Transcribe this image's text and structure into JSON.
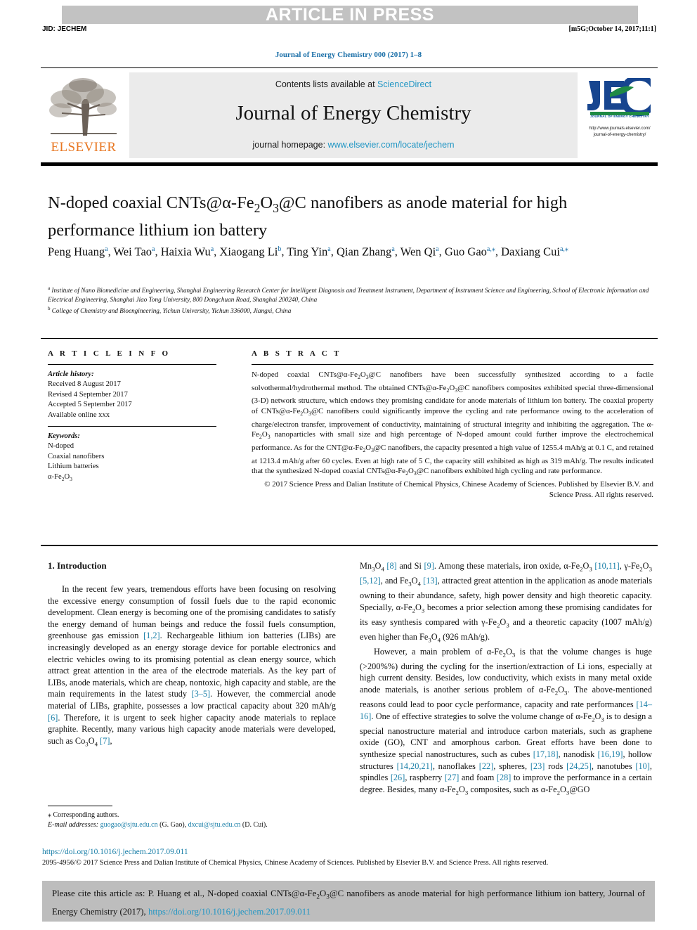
{
  "header": {
    "press_banner": "ARTICLE IN PRESS",
    "jid": "JID: JECHEM",
    "stamp": "[m5G;October 14, 2017;11:1]",
    "journal_ref": "Journal of Energy Chemistry 000 (2017) 1–8"
  },
  "masthead": {
    "contents_prefix": "Contents lists available at ",
    "contents_link": "ScienceDirect",
    "journal_name": "Journal of Energy Chemistry",
    "homepage_prefix": "journal homepage: ",
    "homepage_link": "www.elsevier.com/locate/jechem",
    "elsevier_wordmark": "ELSEVIER",
    "jec_mark": "JEC",
    "jec_subtitle": "JOURNAL OF ENERGY CHEMISTRY",
    "jec_url_line1": "http://www.journals.elsevier.com/",
    "jec_url_line2": "journal-of-energy-chemistry/"
  },
  "article": {
    "title_html": "N-doped coaxial CNTs@&#945;-Fe<sub>2</sub>O<sub>3</sub>@C nanofibers as anode material for high performance lithium ion battery",
    "authors_html": "Peng Huang<sup>a</sup>, Wei Tao<sup>a</sup>, Haixia Wu<sup>a</sup>, Xiaogang Li<sup>b</sup>, Ting Yin<sup>a</sup>, Qian Zhang<sup>a</sup>, Wen Qi<sup>a</sup>, Guo Gao<sup>a,&#8270;</sup>, Daxiang Cui<sup>a,&#8270;</sup>",
    "affiliation_a": "Institute of Nano Biomedicine and Engineering, Shanghai Engineering Research Center for Intelligent Diagnosis and Treatment Instrument, Department of Instrument Science and Engineering, School of Electronic Information and Electrical Engineering, Shanghai Jiao Tong University, 800 Dongchuan Road, Shanghai 200240, China",
    "affiliation_b": "College of Chemistry and Bioengineering, Yichun University, Yichun 336000, Jiangxi, China"
  },
  "article_info": {
    "heading": "A R T I C L E   I N F O",
    "history_label": "Article history:",
    "history": [
      "Received 8 August 2017",
      "Revised 4 September 2017",
      "Accepted 5 September 2017",
      "Available online xxx"
    ],
    "keywords_label": "Keywords:",
    "keywords_html": [
      "N-doped",
      "Coaxial nanofibers",
      "Lithium batteries",
      "&#945;-Fe<sub>2</sub>O<sub>3</sub>"
    ]
  },
  "abstract": {
    "heading": "A B S T R A C T",
    "body_html": "N-doped coaxial CNTs@&#945;-Fe<sub>2</sub>O<sub>3</sub>@C nanofibers have been successfully synthesized according to a facile solvothermal/hydrothermal method. The obtained CNTs@&#945;-Fe<sub>2</sub>O<sub>3</sub>@C nanofibers composites exhibited special three-dimensional (3-D) network structure, which endows they promising candidate for anode materials of lithium ion battery. The coaxial property of CNTs@&#945;-Fe<sub>2</sub>O<sub>3</sub>@C nanofibers could significantly improve the cycling and rate performance owing to the acceleration of charge/electron transfer, improvement of conductivity, maintaining of structural integrity and inhibiting the aggregation. The &#945;-Fe<sub>2</sub>O<sub>3</sub> nanoparticles with small size and high percentage of N-doped amount could further improve the electrochemical performance. As for the CNT@&#945;-Fe<sub>2</sub>O<sub>3</sub>@C nanofibers, the capacity presented a high value of 1255.4 mAh/g at 0.1 C, and retained at 1213.4 mAh/g after 60 cycles. Even at high rate of 5 C, the capacity still exhibited as high as 319 mAh/g. The results indicated that the synthesized N-doped coaxial CNTs@&#945;-Fe<sub>2</sub>O<sub>3</sub>@C nanofibers exhibited high cycling and rate performance.",
    "copyright_html": "&#169; 2017 Science Press and Dalian Institute of Chemical Physics, Chinese Academy of Sciences. Published by Elsevier B.V. and Science Press. All rights reserved."
  },
  "introduction": {
    "heading": "1. Introduction",
    "left_paragraph_html": "In the recent few years, tremendous efforts have been focusing on resolving the excessive energy consumption of fossil fuels due to the rapid economic development. Clean energy is becoming one of the promising candidates to satisfy the energy demand of human beings and reduce the fossil fuels consumption, greenhouse gas emission <span class=\"cite\">[1,2]</span>. Rechargeable lithium ion batteries (LIBs) are increasingly developed as an energy storage device for portable electronics and electric vehicles owing to its promising potential as clean energy source, which attract great attention in the area of the electrode materials. As the key part of LIBs, anode materials, which are cheap, nontoxic, high capacity and stable, are the main requirements in the latest study <span class=\"cite\">[3&#8211;5]</span>. However, the commercial anode material of LIBs, graphite, possesses a low practical capacity about 320 mAh/g <span class=\"cite\">[6]</span>. Therefore, it is urgent to seek higher capacity anode materials to replace graphite. Recently, many various high capacity anode materials were developed, such as Co<sub>3</sub>O<sub>4</sub> <span class=\"cite\">[7]</span>,",
    "right_paragraph_1_html": "Mn<sub>3</sub>O<sub>4</sub> <span class=\"cite\">[8]</span> and Si <span class=\"cite\">[9]</span>. Among these materials, iron oxide, &#945;-Fe<sub>2</sub>O<sub>3</sub> <span class=\"cite\">[10,11]</span>, &#947;-Fe<sub>2</sub>O<sub>3</sub> <span class=\"cite\">[5,12]</span>, and Fe<sub>3</sub>O<sub>4</sub> <span class=\"cite\">[13]</span>, attracted great attention in the application as anode materials owning to their abundance, safety, high power density and high theoretic capacity. Specially, &#945;-Fe<sub>2</sub>O<sub>3</sub> becomes a prior selection among these promising candidates for its easy synthesis compared with &#947;-Fe<sub>2</sub>O<sub>3</sub> and a theoretic capacity (1007 mAh/g) even higher than Fe<sub>3</sub>O<sub>4</sub> (926 mAh/g).",
    "right_paragraph_2_html": "However, a main problem of &#945;-Fe<sub>2</sub>O<sub>3</sub> is that the volume changes is huge (&gt;200%%) during the cycling for the insertion/extraction of Li ions, especially at high current density. Besides, low conductivity, which exists in many metal oxide anode materials, is another serious problem of &#945;-Fe<sub>2</sub>O<sub>3</sub>. The above-mentioned reasons could lead to poor cycle performance, capacity and rate performances <span class=\"cite\">[14&#8211;16]</span>. One of effective strategies to solve the volume change of &#945;-Fe<sub>2</sub>O<sub>3</sub> is to design a special nanostructure material and introduce carbon materials, such as graphene oxide (GO), CNT and amorphous carbon. Great efforts have been done to synthesize special nanostructures, such as cubes <span class=\"cite\">[17,18]</span>, nanodisk <span class=\"cite\">[16,19]</span>, hollow structures <span class=\"cite\">[14,20,21]</span>, nanoflakes <span class=\"cite\">[22]</span>, spheres, <span class=\"cite\">[23]</span> rods <span class=\"cite\">[24,25]</span>, nanotubes <span class=\"cite\">[10]</span>, spindles <span class=\"cite\">[26]</span>, raspberry <span class=\"cite\">[27]</span> and foam <span class=\"cite\">[28]</span> to improve the performance in a certain degree. Besides, many &#945;-Fe<sub>2</sub>O<sub>3</sub> composites, such as &#945;-Fe<sub>2</sub>O<sub>3</sub>@GO"
  },
  "footnotes": {
    "corresponding": "&#8270; Corresponding authors.",
    "email_html": "<span class=\"em\">E-mail addresses:</span> <span class=\"mail\">guogao@sjtu.edu.cn</span> (G. Gao), <span class=\"mail\">dxcui@sjtu.edu.cn</span> (D. Cui).",
    "doi": "https://doi.org/10.1016/j.jechem.2017.09.011",
    "issn_html": "2095-4956/&#169; 2017 Science Press and Dalian Institute of Chemical Physics, Chinese Academy of Sciences. Published by Elsevier B.V. and Science Press. All rights reserved."
  },
  "cite_box": {
    "text_html": "Please cite this article as: P. Huang et al., N-doped coaxial CNTs@&#945;-Fe<sub>2</sub>O<sub>3</sub>@C nanofibers as anode material for high performance lithium ion battery, Journal of Energy Chemistry (2017), <span class=\"link\">https://doi.org/10.1016/j.jechem.2017.09.011</span>"
  },
  "colors": {
    "link_blue": "#2196c4",
    "cite_blue": "#1a7fa8",
    "banner_gray": "#c2c2c2",
    "band_gray": "#ebebeb",
    "cite_box_gray": "#bdbdbd",
    "elsevier_orange": "#e87722",
    "jec_blue": "#0d4f9e",
    "jec_green": "#1f8a44"
  }
}
